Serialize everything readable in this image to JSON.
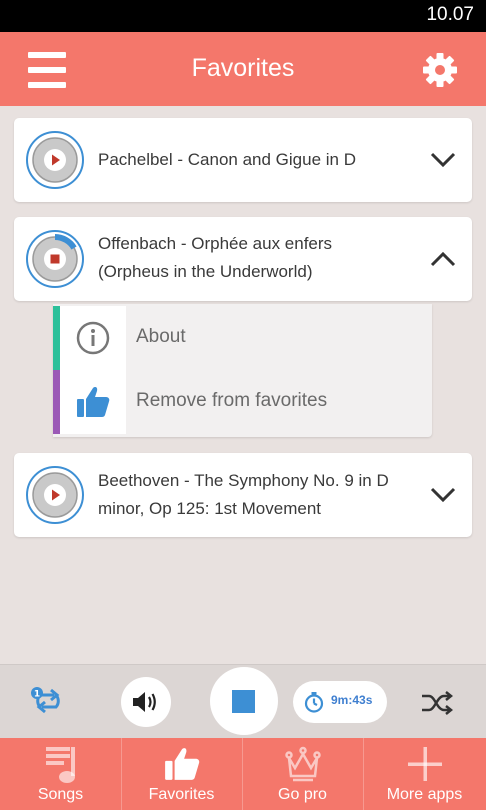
{
  "status": {
    "time": "10.07"
  },
  "header": {
    "title": "Favorites",
    "menu_icon": "hamburger-menu-icon",
    "settings_icon": "gear-icon"
  },
  "tracks": [
    {
      "title": "Pachelbel - Canon and Gigue in D",
      "state": "paused",
      "expanded": false
    },
    {
      "title_line1": "Offenbach - Orphée aux enfers",
      "title_line2": "(Orpheus in the Underworld)",
      "state": "playing",
      "expanded": true
    },
    {
      "title_line1": "Beethoven - The Symphony No. 9 in D",
      "title_line2": "minor, Op 125: 1st Movement",
      "state": "paused",
      "expanded": false
    }
  ],
  "submenu": {
    "about_label": "About",
    "remove_label": "Remove from favorites",
    "about_color": "#2cc09a",
    "remove_color": "#9b59b6"
  },
  "player": {
    "timer": "9m:43s"
  },
  "nav": [
    {
      "label": "Songs",
      "icon": "music-note-icon"
    },
    {
      "label": "Favorites",
      "icon": "thumbs-up-icon"
    },
    {
      "label": "Go pro",
      "icon": "crown-icon"
    },
    {
      "label": "More apps",
      "icon": "plus-icon"
    }
  ],
  "colors": {
    "accent": "#f4776b",
    "blue": "#3d8fd4",
    "background": "#e8e1df"
  }
}
